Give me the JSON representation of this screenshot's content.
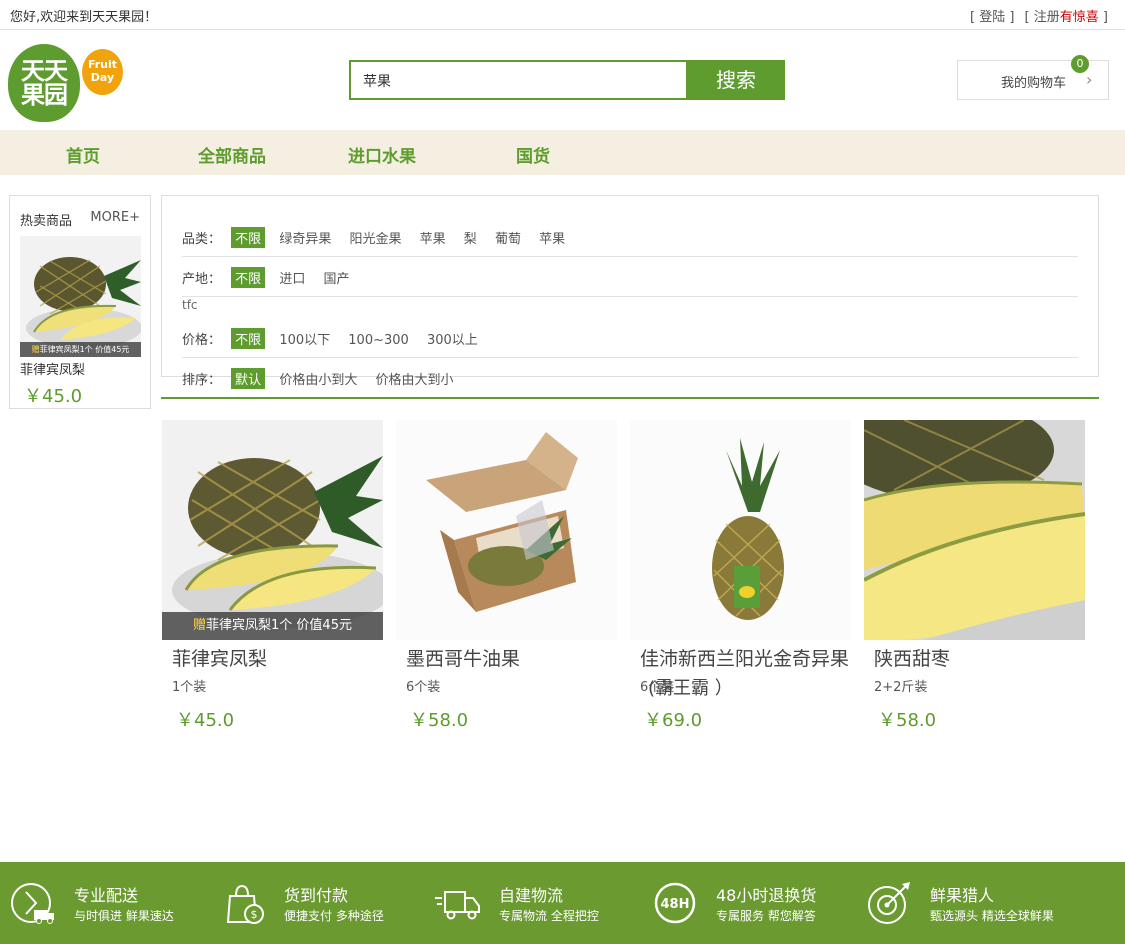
{
  "topbar": {
    "welcome": "您好,欢迎来到天天果园！",
    "login": "[ 登陆 ]",
    "register": "[ 注册",
    "surprise": "有惊喜",
    "register_end": "]"
  },
  "logo": {
    "cn_line1": "天天",
    "cn_line2": "果园",
    "en_line1": "Fruit",
    "en_line2": "Day"
  },
  "search": {
    "value": "苹果",
    "button": "搜索"
  },
  "cart": {
    "label": "我的购物车",
    "count": "0"
  },
  "nav": {
    "items": [
      "首页",
      "全部商品",
      "进口水果",
      "国货"
    ]
  },
  "hot": {
    "title": "热卖商品",
    "more": "MORE+",
    "product": {
      "name": "菲律宾凤梨",
      "price": "￥45.0",
      "promo_gift": "赠",
      "promo_text": "菲律宾凤梨1个 价值45元"
    }
  },
  "filters": {
    "category": {
      "label": "品类：",
      "options": [
        "不限",
        "绿奇异果",
        "阳光金果",
        "苹果",
        "梨",
        "葡萄",
        "苹果"
      ]
    },
    "origin": {
      "label": "产地：",
      "options": [
        "不限",
        "进口",
        "国产"
      ]
    },
    "tfc": "tfc",
    "price": {
      "label": "价格：",
      "options": [
        "不限",
        "100以下",
        "100~300",
        "300以上"
      ]
    },
    "sort": {
      "label": "排序：",
      "options": [
        "默认",
        "价格由小到大",
        "价格由大到小"
      ]
    }
  },
  "products": [
    {
      "name": "菲律宾凤梨",
      "spec": "1个装",
      "price": "￥45.0",
      "promo_gift": "赠",
      "promo_text": "菲律宾凤梨1个 价值45元"
    },
    {
      "name": "墨西哥牛油果",
      "spec": "6个装",
      "price": "￥58.0"
    },
    {
      "name": "佳沛新西兰阳光金奇异果",
      "spec": "6个装",
      "spec_overlay": "(霸王霸 ）",
      "price": "￥69.0"
    },
    {
      "name": "陕西甜枣",
      "spec": "2+2斤装",
      "price": "￥58.0"
    }
  ],
  "footer": [
    {
      "title": "专业配送",
      "sub": "与时俱进 鲜果速达",
      "icon": "delivery-truck-icon"
    },
    {
      "title": "货到付款",
      "sub": "便捷支付 多种途径",
      "icon": "cash-bag-icon"
    },
    {
      "title": "自建物流",
      "sub": "专属物流 全程把控",
      "icon": "logistics-truck-icon"
    },
    {
      "title": "48小时退换货",
      "sub": "专属服务 帮您解答",
      "icon": "48h-icon"
    },
    {
      "title": "鲜果猎人",
      "sub": "甄选源头 精选全球鲜果",
      "icon": "target-icon"
    }
  ],
  "colors": {
    "brand_green": "#5e9c2f",
    "nav_bg": "#f5efe1",
    "footer_bg": "#6a9a30",
    "accent_orange": "#f0a30a"
  }
}
